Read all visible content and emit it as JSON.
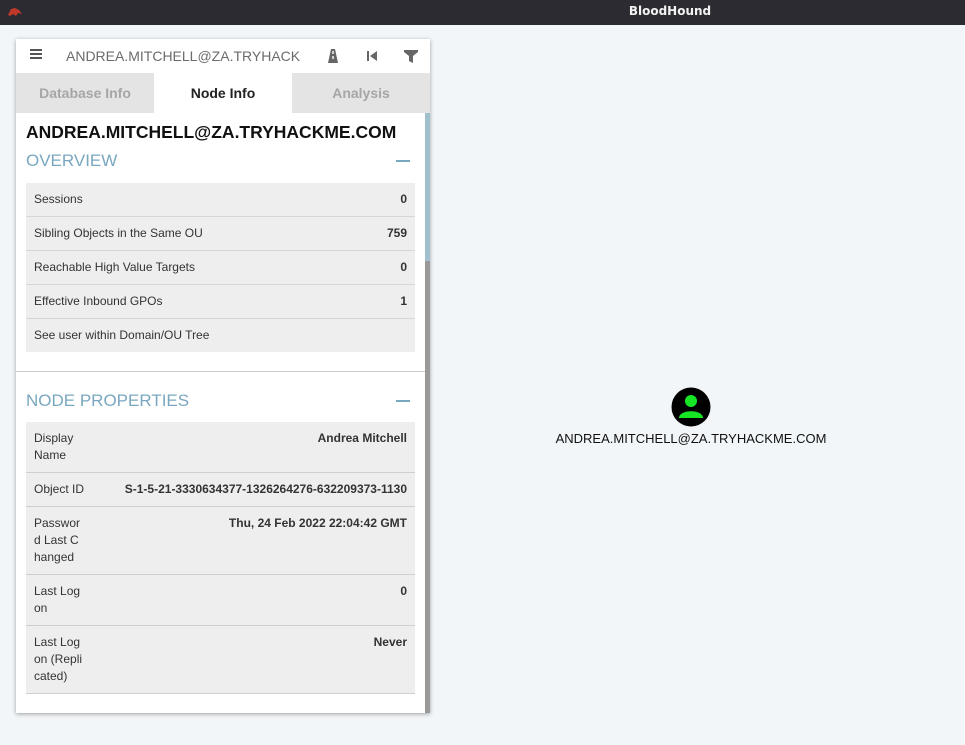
{
  "window": {
    "title": "BloodHound"
  },
  "search": {
    "value": "ANDREA.MITCHELL@ZA.TRYHACK"
  },
  "icons": {
    "menu": "menu-icon",
    "pathfinding": "road-icon",
    "back": "skip-back-icon",
    "filter": "filter-icon",
    "collapse": "minus-icon",
    "user": "user-icon"
  },
  "tabs": [
    {
      "label": "Database Info"
    },
    {
      "label": "Node Info"
    },
    {
      "label": "Analysis"
    }
  ],
  "node": {
    "name": "ANDREA.MITCHELL@ZA.TRYHACKME.COM"
  },
  "overview": {
    "title": "OVERVIEW",
    "rows": [
      {
        "label": "Sessions",
        "value": "0"
      },
      {
        "label": "Sibling Objects in the Same OU",
        "value": "759"
      },
      {
        "label": "Reachable High Value Targets",
        "value": "0"
      },
      {
        "label": "Effective Inbound GPOs",
        "value": "1"
      },
      {
        "label": "See user within Domain/OU Tree",
        "value": ""
      }
    ]
  },
  "properties": {
    "title": "NODE PROPERTIES",
    "rows": [
      {
        "label": "Display Name",
        "value": "Andrea Mitchell"
      },
      {
        "label": "Object ID",
        "value": "S-1-5-21-3330634377-1326264276-632209373-1130"
      },
      {
        "label": "Password Last Changed",
        "value": "Thu, 24 Feb 2022 22:04:42 GMT"
      },
      {
        "label": "Last Logon",
        "value": "0"
      },
      {
        "label": "Last Logon (Replicated)",
        "value": "Never"
      }
    ]
  },
  "graph": {
    "node_label": "ANDREA.MITCHELL@ZA.TRYHACKME.COM"
  },
  "colors": {
    "accent": "#7aa7c0",
    "user_node": "#17e625",
    "titlebar": "#2b2b31"
  }
}
